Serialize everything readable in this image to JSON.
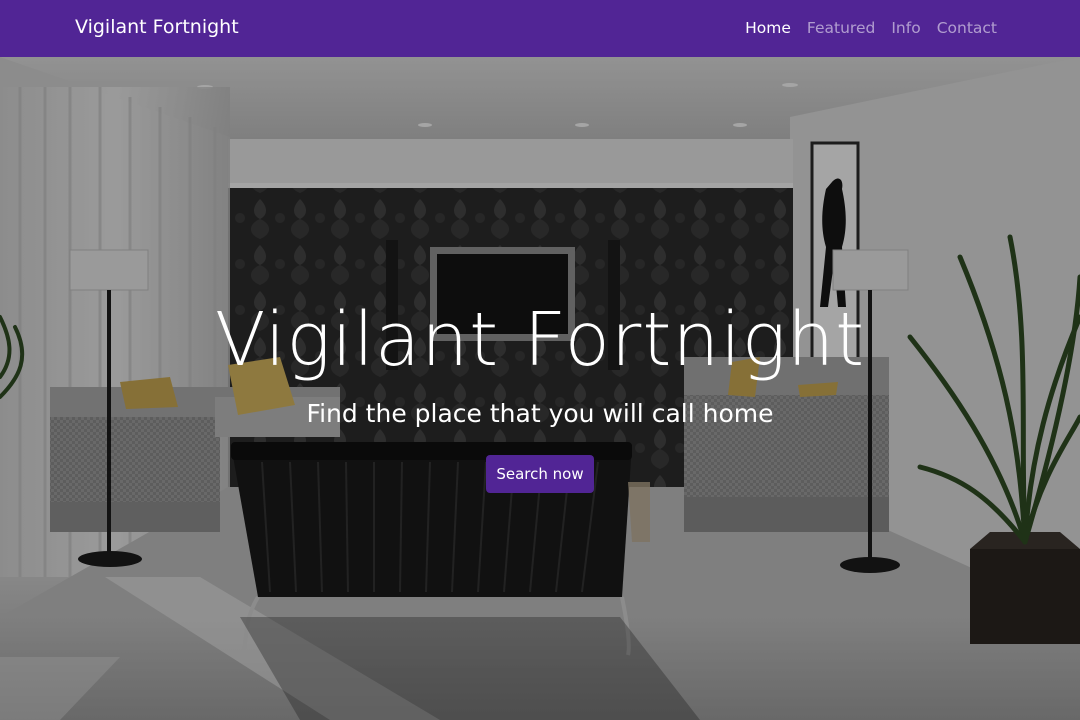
{
  "navbar": {
    "brand": "Vigilant Fortnight",
    "links": [
      {
        "label": "Home",
        "active": true
      },
      {
        "label": "Featured",
        "active": false
      },
      {
        "label": "Info",
        "active": false
      },
      {
        "label": "Contact",
        "active": false
      }
    ]
  },
  "hero": {
    "title": "Vigilant Fortnight",
    "subtitle": "Find the place that you will call home",
    "cta_label": "Search now"
  },
  "colors": {
    "brand": "#512595",
    "nav_text_active": "#ffffff",
    "nav_text_inactive": "#b8a4d6",
    "hero_overlay": "rgba(0,0,0,0.35)"
  },
  "background": {
    "icon": "living-room-photo"
  }
}
